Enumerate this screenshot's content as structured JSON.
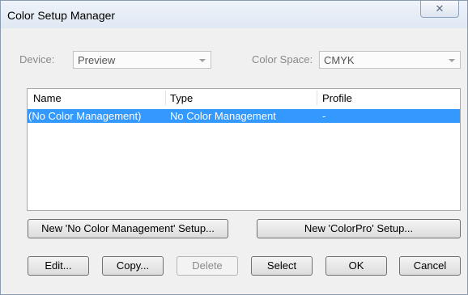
{
  "window": {
    "title": "Color Setup Manager",
    "close_glyph": "✕"
  },
  "device": {
    "label": "Device:",
    "value": "Preview"
  },
  "color_space": {
    "label": "Color Space:",
    "value": "CMYK"
  },
  "list": {
    "columns": [
      "Name",
      "Type",
      "Profile"
    ],
    "rows": [
      {
        "name": "(No Color Management)",
        "type": "No Color Management",
        "profile": "-",
        "selected": true
      }
    ]
  },
  "buttons": {
    "new_no_cm": "New 'No Color Management' Setup...",
    "new_colorpro": "New 'ColorPro' Setup...",
    "edit": "Edit...",
    "copy": "Copy...",
    "delete": "Delete",
    "select": "Select",
    "ok": "OK",
    "cancel": "Cancel"
  },
  "colors": {
    "selection": "#3399ff",
    "window_bg": "#f0f0f0"
  }
}
